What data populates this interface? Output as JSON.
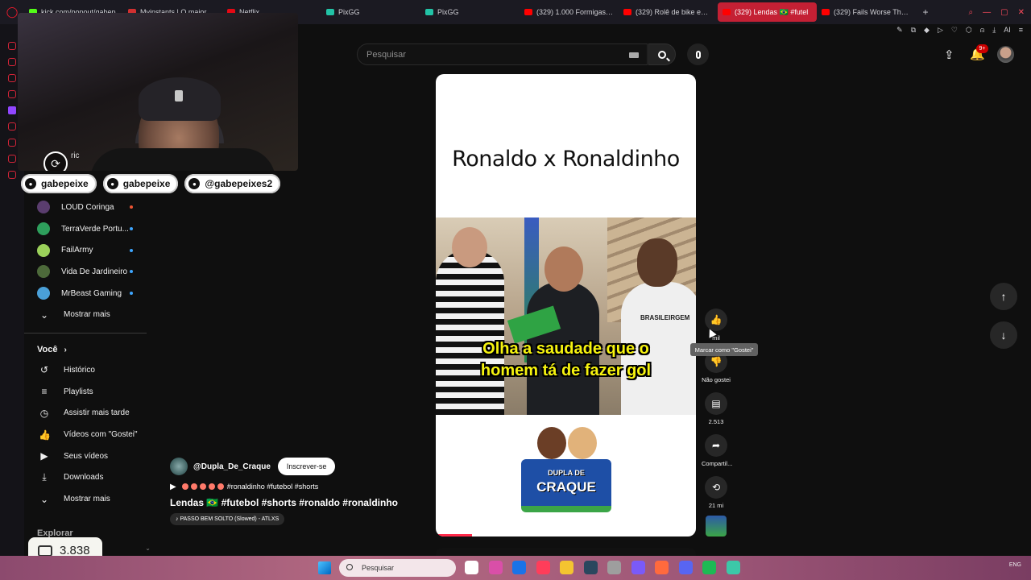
{
  "browser": {
    "tabs": [
      {
        "label": "kick.com/popout/gabep",
        "color": "#53fc18",
        "active": false
      },
      {
        "label": "Myinstants | O maior site",
        "color": "#d13030",
        "active": false
      },
      {
        "label": "Netflix",
        "color": "#e50914",
        "active": false
      },
      {
        "label": "PixGG",
        "color": "#22c3a6",
        "active": false
      },
      {
        "label": "PixGG",
        "color": "#22c3a6",
        "active": false
      },
      {
        "label": "(329) 1.000 Formigas vs",
        "color": "#ff0000",
        "active": false
      },
      {
        "label": "(329) Rolê de bike em Sc",
        "color": "#ff0000",
        "active": false
      },
      {
        "label": "(329) Lendas 🇧🇷 #futel",
        "color": "#ff0000",
        "active": true
      },
      {
        "label": "(329) Fails Worse Than L",
        "color": "#ff0000",
        "active": false
      }
    ],
    "new_tab": "+",
    "toolbar_ai": "AI"
  },
  "webcam": {
    "partial_text": "ric"
  },
  "socials": [
    {
      "label": "gabepeixe",
      "icon": "youtube-icon"
    },
    {
      "label": "gabepeixe",
      "icon": "instagram-icon"
    },
    {
      "label": "@gabepeixes2",
      "icon": "tiktok-icon"
    }
  ],
  "guide": {
    "subscriptions": [
      {
        "label": "LOUD Coringa",
        "avatar_color": "#5a3d6e",
        "live": true
      },
      {
        "label": "TerraVerde Portu...",
        "avatar_color": "#2e9f5c",
        "live": false
      },
      {
        "label": "FailArmy",
        "avatar_color": "#9bd15a",
        "live": false
      },
      {
        "label": "Vida De Jardineiro",
        "avatar_color": "#4d6a3a",
        "live": false
      },
      {
        "label": "MrBeast Gaming",
        "avatar_color": "#4aa0d8",
        "live": false
      }
    ],
    "show_more_1": "Mostrar mais",
    "you_header": "Você",
    "you_items": [
      {
        "label": "Histórico",
        "icon": "history-icon",
        "glyph": "↺"
      },
      {
        "label": "Playlists",
        "icon": "playlists-icon",
        "glyph": "≡"
      },
      {
        "label": "Assistir mais tarde",
        "icon": "watch-later-icon",
        "glyph": "◷"
      },
      {
        "label": "Vídeos com \"Gostei\"",
        "icon": "liked-icon",
        "glyph": "👍"
      },
      {
        "label": "Seus vídeos",
        "icon": "your-videos-icon",
        "glyph": "▶"
      },
      {
        "label": "Downloads",
        "icon": "downloads-icon",
        "glyph": "⤓"
      }
    ],
    "show_more_2": "Mostrar mais",
    "explore": "Explorar"
  },
  "coins": {
    "value": "3.838"
  },
  "search": {
    "placeholder": "Pesquisar"
  },
  "header": {
    "notifications": "9+"
  },
  "short": {
    "title": "Ronaldo x Ronaldinho",
    "caption_line1": "Olha a saudade que o",
    "caption_line2": "homem tá de fazer gol",
    "shirt_text": "BRASILEIRGEM",
    "logo_line1": "DUPLA DE",
    "logo_line2": "CRAQUE",
    "progress": 0.14
  },
  "meta": {
    "channel": "@Dupla_De_Craque",
    "subscribe": "Inscrever-se",
    "hashtags": "#ronaldinho #futebol #shorts",
    "title": "Lendas 🇧🇷 #futebol #shorts #ronaldo #ronaldinho",
    "music": "PASSO BEM SOLTO (Slowed) - ATLXS"
  },
  "actions": {
    "like_count": "mil",
    "like_tooltip": "Marcar como \"Gostei\"",
    "dislike_label": "Não gostei",
    "comments_count": "2.513",
    "share_label": "Compartil...",
    "remix_count": "21 mi"
  },
  "taskbar": {
    "search": "Pesquisar",
    "tray": "ENG",
    "icons": [
      "#ffffff",
      "#d94fa8",
      "#1a73e8",
      "#ff3d5a",
      "#f4c430",
      "#2a475e",
      "#9e9e9e",
      "#7a5af8",
      "#ff6a3d",
      "#5865f2",
      "#1db954",
      "#3cc8a8"
    ]
  }
}
